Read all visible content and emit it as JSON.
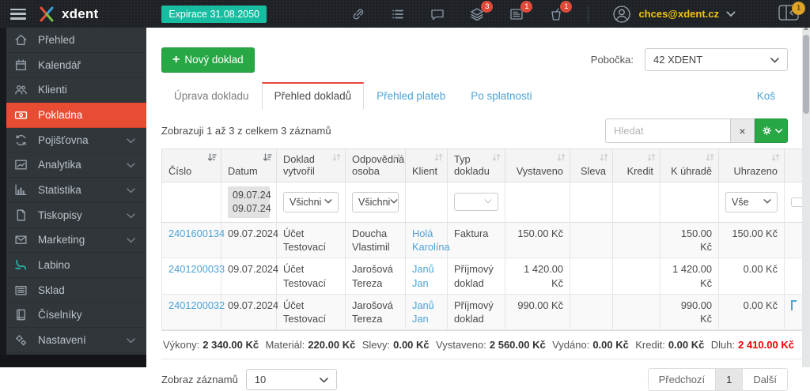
{
  "topbar": {
    "brand": "xdent",
    "expiration": "Expirace 31.08.2050",
    "user_email": "chces@xdent.cz",
    "badges": {
      "layers": "3",
      "news": "1",
      "cup": "1",
      "corner": "1"
    }
  },
  "icons": {
    "plus": "+",
    "chevron_down": "⌄",
    "close": "×"
  },
  "colors": {
    "accent_red": "#e84c32",
    "teal": "#17bda1",
    "green": "#28a745",
    "link_blue": "#4da3d6",
    "debt_red": "#f10000",
    "email_yellow": "#f1c40f"
  },
  "sidebar": {
    "items": [
      {
        "label": "Přehled"
      },
      {
        "label": "Kalendář"
      },
      {
        "label": "Klienti"
      },
      {
        "label": "Pokladna"
      },
      {
        "label": "Pojišťovna"
      },
      {
        "label": "Analytika"
      },
      {
        "label": "Statistika"
      },
      {
        "label": "Tiskopisy"
      },
      {
        "label": "Marketing"
      },
      {
        "label": "Labino"
      },
      {
        "label": "Sklad"
      },
      {
        "label": "Číselníky"
      },
      {
        "label": "Nastavení"
      }
    ]
  },
  "toolbar": {
    "new_document": "Nový doklad",
    "branch_label": "Pobočka:",
    "branch_value": "42 XDENT"
  },
  "tabs": [
    {
      "label": "Úprava dokladu"
    },
    {
      "label": "Přehled dokladů"
    },
    {
      "label": "Přehled plateb"
    },
    {
      "label": "Po splatnosti"
    },
    {
      "label": "Koš"
    }
  ],
  "table": {
    "summary": "Zobrazuji 1 až 3 z celkem 3 záznamů",
    "search_placeholder": "Hledat",
    "columns": [
      "Číslo",
      "Datum",
      "Doklad vytvořil",
      "Odpovědná osoba",
      "Klient",
      "Typ dokladu",
      "Vystaveno",
      "Sleva",
      "Kredit",
      "K úhradě",
      "Uhrazeno"
    ],
    "filters": {
      "date_from": "09.07.24",
      "date_to": "09.07.24",
      "creator": "Všichni",
      "responsible": "Všichni",
      "paid": "Vše"
    },
    "rows": [
      {
        "number": "2401600134",
        "date": "09.07.2024",
        "creator": "Účet Testovací",
        "responsible": "Doucha Vlastimil",
        "client": "Holá Karolína",
        "type": "Faktura",
        "issued": "150.00 Kč",
        "discount": "",
        "credit": "",
        "due": "150.00 Kč",
        "paid": "150.00 Kč"
      },
      {
        "number": "2401200033",
        "date": "09.07.2024",
        "creator": "Účet Testovací",
        "responsible": "Jarošová Tereza",
        "client": "Janů Jan",
        "type": "Příjmový doklad",
        "issued": "1 420.00 Kč",
        "discount": "",
        "credit": "",
        "due": "1 420.00 Kč",
        "paid": "0.00 Kč"
      },
      {
        "number": "2401200032",
        "date": "09.07.2024",
        "creator": "Účet Testovací",
        "responsible": "Jarošová Tereza",
        "client": "Janů Jan",
        "type": "Příjmový doklad",
        "issued": "990.00 Kč",
        "discount": "",
        "credit": "",
        "due": "990.00 Kč",
        "paid": "0.00 Kč"
      }
    ],
    "totals": [
      {
        "label": "Výkony:",
        "value": "2 340.00 Kč"
      },
      {
        "label": "Materiál:",
        "value": "220.00 Kč"
      },
      {
        "label": "Slevy:",
        "value": "0.00 Kč"
      },
      {
        "label": "Vystaveno:",
        "value": "2 560.00 Kč"
      },
      {
        "label": "Vydáno:",
        "value": "0.00 Kč"
      },
      {
        "label": "Kredit:",
        "value": "0.00 Kč"
      },
      {
        "label": "Dluh:",
        "value": "2 410.00 Kč"
      }
    ]
  },
  "pagination": {
    "page_size_label": "Zobraz záznamů",
    "page_size": "10",
    "prev": "Předchozí",
    "page": "1",
    "next": "Další"
  }
}
